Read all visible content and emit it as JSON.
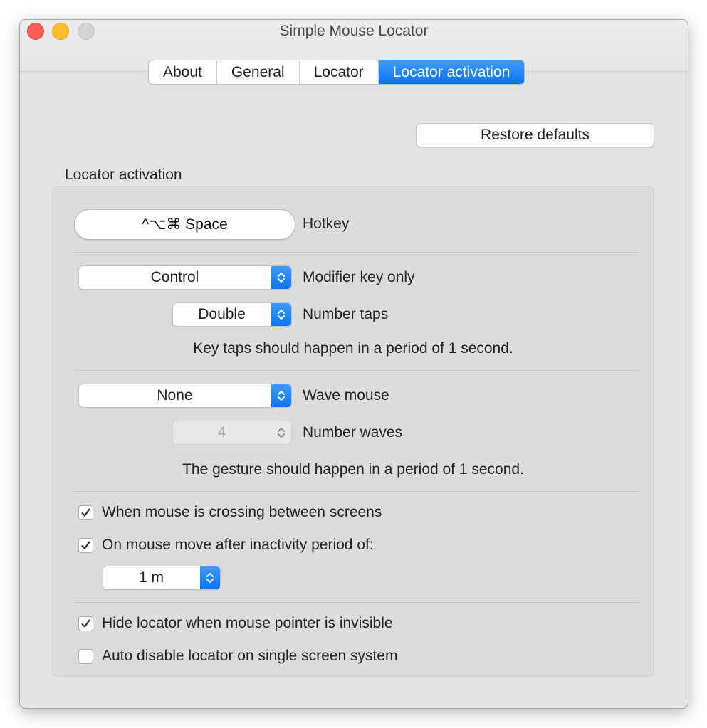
{
  "window": {
    "title": "Simple Mouse Locator"
  },
  "tabs": [
    {
      "label": "About"
    },
    {
      "label": "General"
    },
    {
      "label": "Locator"
    },
    {
      "label": "Locator activation"
    }
  ],
  "restore_button": "Restore defaults",
  "section_label": "Locator activation",
  "hotkey": {
    "value": "^⌥⌘ Space",
    "label": "Hotkey"
  },
  "modifier": {
    "value": "Control",
    "label": "Modifier key only"
  },
  "taps": {
    "value": "Double",
    "label": "Number taps"
  },
  "taps_note": "Key taps should happen in a period of 1 second.",
  "wave": {
    "value": "None",
    "label": "Wave mouse"
  },
  "waves": {
    "value": "4",
    "label": "Number waves"
  },
  "gesture_note": "The gesture should happen in a period of 1 second.",
  "checkboxes": [
    {
      "label": "When mouse is crossing between screens",
      "checked": true
    },
    {
      "label": "On mouse move after inactivity period of:",
      "checked": true
    },
    {
      "label": "Hide locator when mouse pointer is invisible",
      "checked": true
    },
    {
      "label": "Auto disable locator on single screen system",
      "checked": false
    }
  ],
  "inactivity": {
    "value": "1 m"
  },
  "colors": {
    "accent": "#0a74f5",
    "close": "#fc5f57",
    "minimize": "#fdbc2e",
    "zoom": "#d3d3d3"
  }
}
